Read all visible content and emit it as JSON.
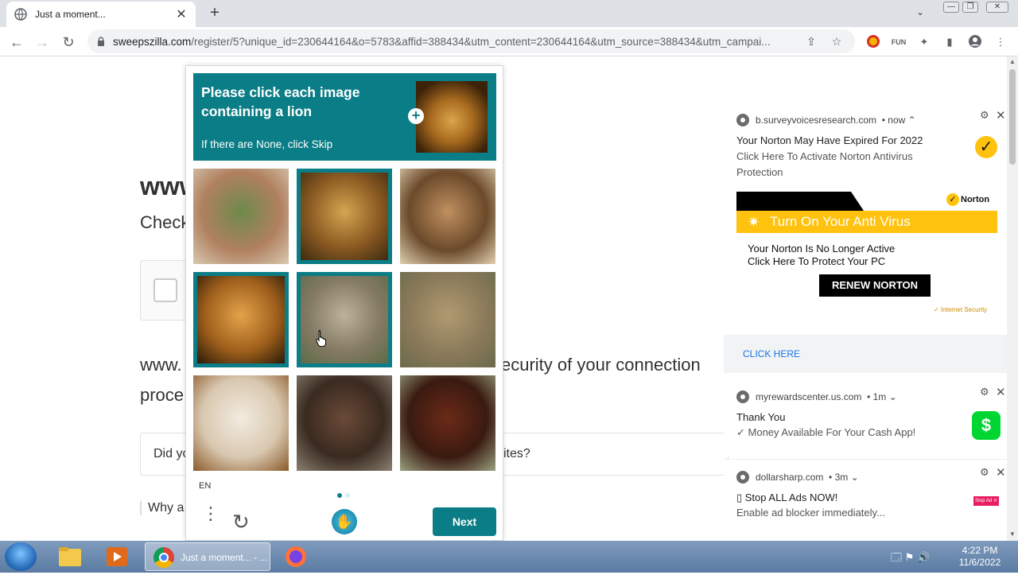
{
  "browser": {
    "tab_title": "Just a moment...",
    "new_tab": "+",
    "tab_close": "✕",
    "tab_list": "⌄",
    "window_controls": [
      "—",
      "❐",
      "✕"
    ],
    "url_domain": "sweepszilla.com",
    "url_path": "/register/5?unique_id=230644164&o=5783&affid=388434&utm_content=230644164&utm_source=388434&utm_campai...",
    "nav": {
      "back": "←",
      "forward": "→",
      "reload": "↻"
    }
  },
  "page": {
    "heading": "www",
    "subheading": "Check",
    "text1_left": "www.",
    "text1_right": "ecurity of your connection",
    "text2": "proce",
    "did_left": "Did yo",
    "did_right": "ites?",
    "why": "Why a"
  },
  "captcha": {
    "prompt": "Please click each image containing a lion",
    "skip_hint": "If there are None, click Skip",
    "plus": "+",
    "tiles": [
      {
        "subject": "horse",
        "selected": false,
        "colors": [
          "#6d8a4a",
          "#b08060",
          "#d8c9b0"
        ]
      },
      {
        "subject": "lion",
        "selected": true,
        "colors": [
          "#d4a550",
          "#8a5a22",
          "#3d2a10"
        ]
      },
      {
        "subject": "dog",
        "selected": false,
        "colors": [
          "#c09060",
          "#6b4a2a",
          "#e0d0b0"
        ]
      },
      {
        "subject": "lion",
        "selected": true,
        "colors": [
          "#e3a34a",
          "#a0601c",
          "#2b1a08"
        ]
      },
      {
        "subject": "lion",
        "selected": true,
        "colors": [
          "#bcb29a",
          "#857a64",
          "#5c6b46"
        ]
      },
      {
        "subject": "lion",
        "selected": false,
        "colors": [
          "#b09a70",
          "#8a7a5a",
          "#6a6a4a"
        ]
      },
      {
        "subject": "dog",
        "selected": false,
        "colors": [
          "#f2ebe0",
          "#d9c8b0",
          "#8a5a2a"
        ]
      },
      {
        "subject": "horse",
        "selected": false,
        "colors": [
          "#6a4a38",
          "#3a2a20",
          "#8a8070"
        ]
      },
      {
        "subject": "horse",
        "selected": false,
        "colors": [
          "#6b2a18",
          "#3a1a10",
          "#9aa080"
        ]
      }
    ],
    "language": "EN",
    "menu": "⋮",
    "refresh": "↻",
    "logo": "✋",
    "next": "Next"
  },
  "notifications": [
    {
      "source": "b.surveyvoicesresearch.com",
      "time": "• now ⌃",
      "title": "Your Norton May Have Expired For 2022",
      "body": "Click Here To Activate Norton Antivirus Protection",
      "badge": "✓",
      "banner": {
        "logo": "Norton",
        "logo_check": "✓",
        "bar": "Turn On Your Anti Virus",
        "bar_icon": "✷",
        "line1": "Your Norton Is No Longer Active",
        "line2": "Click Here To Protect Your PC",
        "button": "RENEW NORTON",
        "footer": "✓ Internet Security"
      },
      "action": "CLICK HERE"
    },
    {
      "source": "myrewardscenter.us.com",
      "time": "• 1m ⌄",
      "title": "Thank You",
      "body": "✓ Money Available For Your Cash App!",
      "badge": "$"
    },
    {
      "source": "dollarsharp.com",
      "time": "• 3m ⌄",
      "title": "▯ Stop ALL Ads NOW!",
      "body": "Enable ad blocker immediately...",
      "badge": "Stop Ad ✕"
    }
  ],
  "notif_gear": "⚙",
  "notif_close": "✕",
  "taskbar": {
    "chrome_label": "Just a moment... - ...",
    "time": "4:22 PM",
    "date": "11/6/2022",
    "tray": "🗔 ⚑ 🔊"
  },
  "colors": {
    "captcha_teal": "#0b7d86",
    "norton_yellow": "#ffc20e",
    "cashapp_green": "#00d632"
  }
}
